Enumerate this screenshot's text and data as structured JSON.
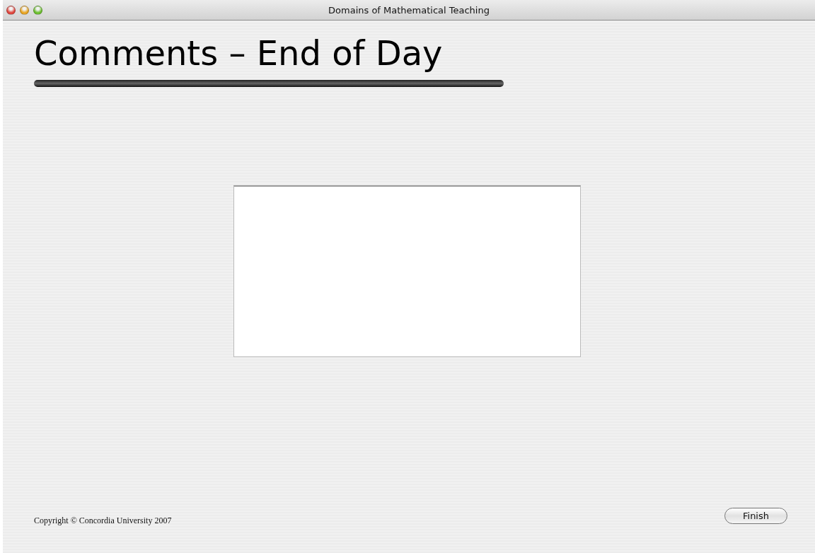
{
  "window": {
    "title": "Domains of Mathematical Teaching"
  },
  "heading": "Comments – End of Day",
  "footer": {
    "copyright": "Copyright © Concordia University 2007",
    "button": "Finish"
  }
}
